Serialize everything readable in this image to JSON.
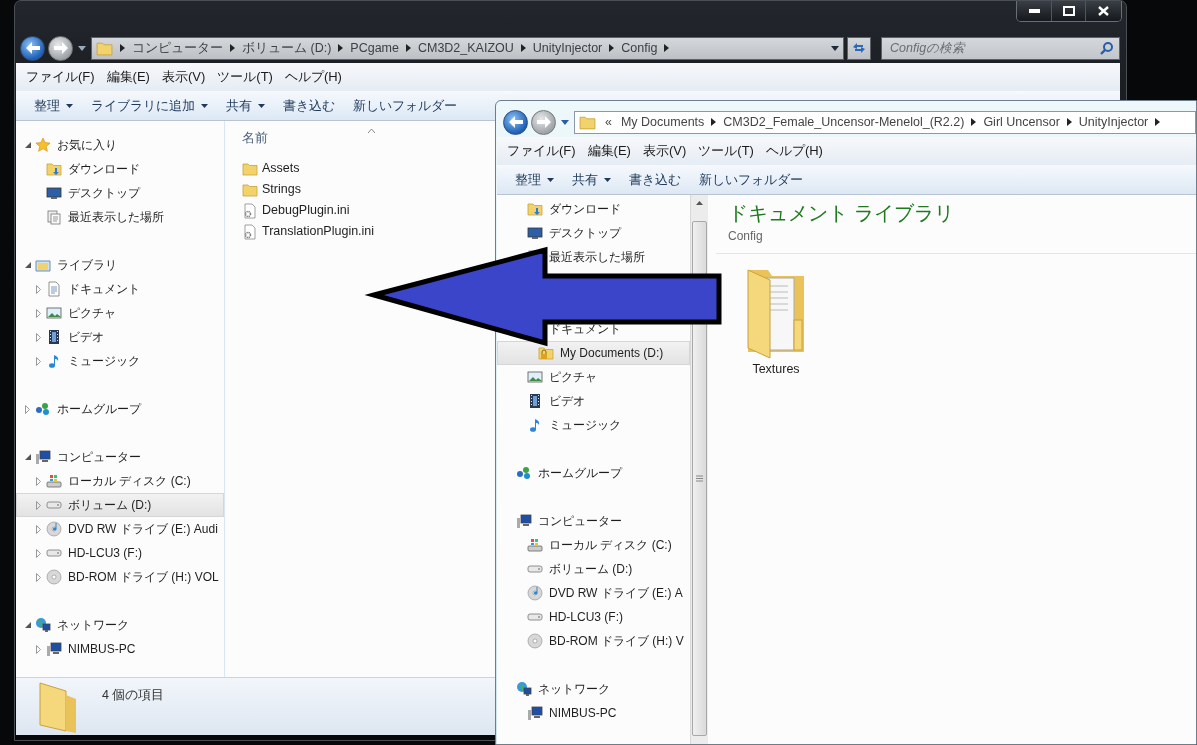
{
  "windows": [
    {
      "caption_buttons": true,
      "address": {
        "segments": [
          "コンピューター",
          "ボリューム (D:)",
          "PCgame",
          "CM3D2_KAIZOU",
          "UnityInjector",
          "Config"
        ]
      },
      "search": {
        "placeholder": "Configの検索"
      },
      "menu": [
        "ファイル(F)",
        "編集(E)",
        "表示(V)",
        "ツール(T)",
        "ヘルプ(H)"
      ],
      "toolbar": [
        {
          "label": "整理",
          "dropdown": true
        },
        {
          "label": "ライブラリに追加",
          "dropdown": true
        },
        {
          "label": "共有",
          "dropdown": true
        },
        {
          "label": "書き込む",
          "dropdown": false
        },
        {
          "label": "新しいフォルダー",
          "dropdown": false
        }
      ],
      "nav": {
        "sections": [
          {
            "header": {
              "label": "お気に入り",
              "kind": "favorites",
              "expanded": true,
              "selected": false
            },
            "items": [
              {
                "label": "ダウンロード",
                "kind": "download",
                "selected": false
              },
              {
                "label": "デスクトップ",
                "kind": "desktop",
                "selected": false
              },
              {
                "label": "最近表示した場所",
                "kind": "recent",
                "selected": false
              }
            ]
          },
          {
            "header": {
              "label": "ライブラリ",
              "kind": "libraries",
              "expanded": true,
              "selected": false
            },
            "items": [
              {
                "label": "ドキュメント",
                "kind": "documents",
                "expanded": false,
                "selected": false
              },
              {
                "label": "ピクチャ",
                "kind": "pictures",
                "expanded": false,
                "selected": false
              },
              {
                "label": "ビデオ",
                "kind": "videos",
                "expanded": false,
                "selected": false
              },
              {
                "label": "ミュージック",
                "kind": "music",
                "expanded": false,
                "selected": false
              }
            ]
          },
          {
            "header": {
              "label": "ホームグループ",
              "kind": "homegroup",
              "expanded": false,
              "selected": false
            }
          },
          {
            "header": {
              "label": "コンピューター",
              "kind": "computer",
              "expanded": true,
              "selected": false
            },
            "items": [
              {
                "label": "ローカル ディスク (C:)",
                "kind": "system-drive",
                "expanded": false,
                "selected": false
              },
              {
                "label": "ボリューム (D:)",
                "kind": "drive",
                "expanded": false,
                "selected": true
              },
              {
                "label": "DVD RW ドライブ (E:) Audi",
                "kind": "dvd",
                "expanded": false,
                "selected": false
              },
              {
                "label": "HD-LCU3 (F:)",
                "kind": "drive",
                "expanded": false,
                "selected": false
              },
              {
                "label": "BD-ROM ドライブ (H:) VOL",
                "kind": "bd",
                "expanded": false,
                "selected": false
              }
            ]
          },
          {
            "header": {
              "label": "ネットワーク",
              "kind": "network",
              "expanded": true,
              "selected": false
            },
            "items": [
              {
                "label": "NIMBUS-PC",
                "kind": "pc",
                "expanded": false,
                "selected": false
              }
            ]
          }
        ]
      },
      "content": {
        "column": "名前",
        "files": [
          {
            "name": "Assets",
            "kind": "folder"
          },
          {
            "name": "Strings",
            "kind": "folder"
          },
          {
            "name": "DebugPlugin.ini",
            "kind": "ini"
          },
          {
            "name": "TranslationPlugin.ini",
            "kind": "ini"
          }
        ]
      },
      "status": {
        "text": "4 個の項目"
      }
    },
    {
      "address": {
        "overflow_mark": "«",
        "segments": [
          "My Documents",
          "CM3D2_Female_Uncensor-Menelol_(R2.2)",
          "Girl Uncensor",
          "UnityInjector"
        ]
      },
      "menu": [
        "ファイル(F)",
        "編集(E)",
        "表示(V)",
        "ツール(T)",
        "ヘルプ(H)"
      ],
      "toolbar": [
        {
          "label": "整理",
          "dropdown": true
        },
        {
          "label": "共有",
          "dropdown": true
        },
        {
          "label": "書き込む",
          "dropdown": false
        },
        {
          "label": "新しいフォルダー",
          "dropdown": false
        }
      ],
      "nav": {
        "scrollbar": true,
        "sections": [
          {
            "items": [
              {
                "label": "ダウンロード",
                "kind": "download",
                "selected": false
              },
              {
                "label": "デスクトップ",
                "kind": "desktop",
                "selected": false
              },
              {
                "label": "最近表示した場所",
                "kind": "recent",
                "selected": false
              }
            ]
          },
          {
            "items": [
              {
                "label": "ドキュメント",
                "selected": false,
                "children": [
                  {
                    "label": "My Documents (D:)",
                    "kind": "locked-folder",
                    "selected": true
                  }
                ]
              },
              {
                "label": "ピクチャ",
                "kind": "pictures",
                "selected": false
              },
              {
                "label": "ビデオ",
                "kind": "videos",
                "selected": false
              },
              {
                "label": "ミュージック",
                "kind": "music",
                "selected": false
              }
            ]
          },
          {
            "header": {
              "label": "ホームグループ",
              "kind": "homegroup",
              "selected": false
            }
          },
          {
            "header": {
              "label": "コンピューター",
              "kind": "computer",
              "selected": false
            },
            "items": [
              {
                "label": "ローカル ディスク (C:)",
                "kind": "system-drive",
                "selected": false
              },
              {
                "label": "ボリューム (D:)",
                "kind": "drive",
                "selected": false
              },
              {
                "label": "DVD RW ドライブ (E:) A",
                "kind": "dvd",
                "selected": false
              },
              {
                "label": "HD-LCU3 (F:)",
                "kind": "drive",
                "selected": false
              },
              {
                "label": "BD-ROM ドライブ (H:) V",
                "kind": "bd",
                "selected": false
              }
            ]
          },
          {
            "header": {
              "label": "ネットワーク",
              "kind": "network",
              "selected": false
            },
            "items": [
              {
                "label": "NIMBUS-PC",
                "kind": "pc",
                "selected": false
              }
            ]
          }
        ]
      },
      "library": {
        "title": "ドキュメント ライブラリ",
        "subtitle": "Config"
      },
      "tiles": [
        {
          "name": "Textures",
          "kind": "folder"
        }
      ]
    }
  ]
}
